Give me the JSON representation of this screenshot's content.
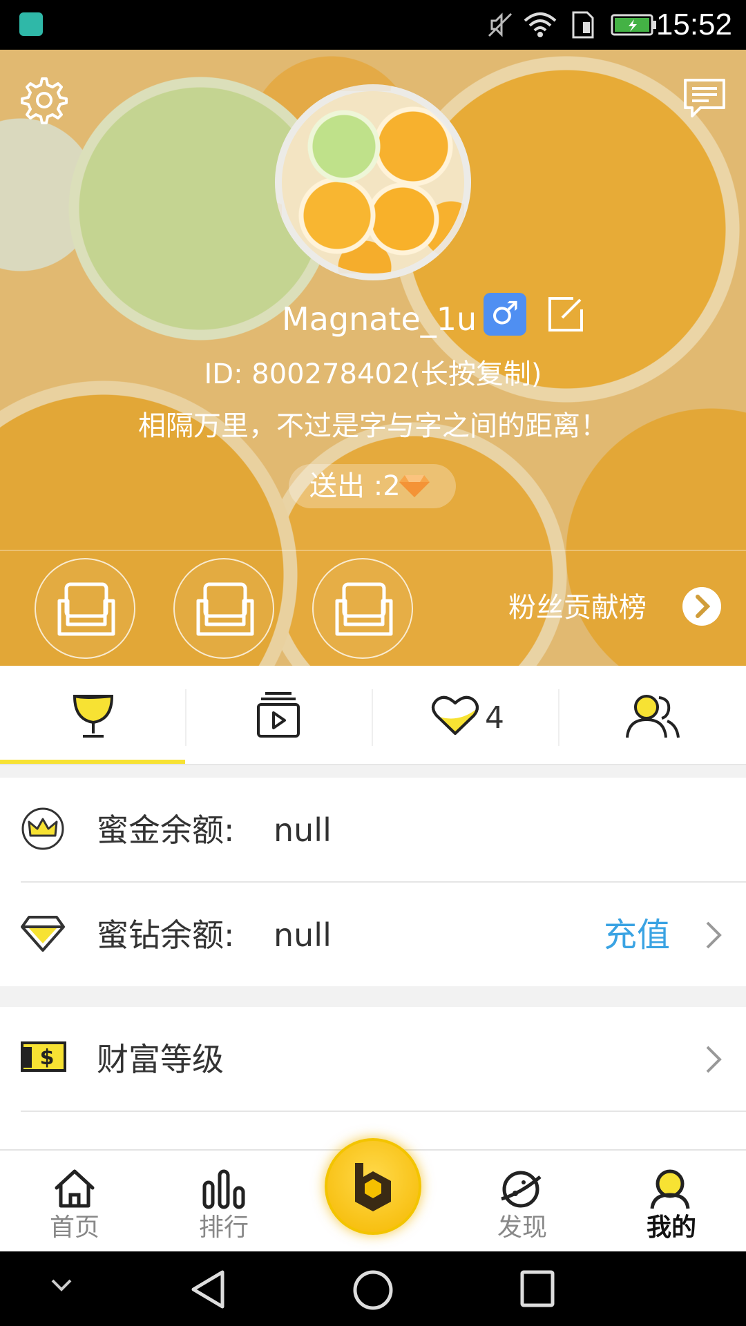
{
  "status_bar": {
    "time": "15:52",
    "icons": [
      "android-app-icon",
      "mute-icon",
      "wifi-icon",
      "sim-icon",
      "battery-charging-icon"
    ]
  },
  "header": {
    "icons": [
      "settings-icon",
      "message-icon"
    ],
    "username": "Magnate_1u",
    "gender_symbol": "♂",
    "user_id": "ID: 800278402(长按复制)",
    "signature": "相隔万里，不过是字与字之间的距离！",
    "sent_label": "送出 :2",
    "sent_icon": "diamond-icon",
    "seat_icon": "sofa-icon",
    "fans_ranking_label": "粉丝贡献榜",
    "colors": {
      "background_tint": "#f0c77b",
      "gender_badge": "#4f8ff2"
    }
  },
  "tabs": {
    "items": [
      {
        "icon": "trophy-icon",
        "active": true
      },
      {
        "icon": "video-icon"
      },
      {
        "icon": "heart-icon",
        "count": "4"
      },
      {
        "icon": "users-icon"
      }
    ],
    "active_color": "#f7e233"
  },
  "list": {
    "gold_balance": {
      "icon": "crown-icon",
      "label": "蜜金余额:",
      "value": "null"
    },
    "diamond_balance": {
      "icon": "diamond-outline-icon",
      "label": "蜜钻余额:",
      "value": "null",
      "action": "充值",
      "action_color": "#3aa3e3"
    },
    "wealth_level": {
      "icon": "money-icon",
      "label": "财富等级"
    }
  },
  "bottom_nav": {
    "items": [
      {
        "label": "首页",
        "icon": "home-icon"
      },
      {
        "label": "排行",
        "icon": "ranking-icon"
      },
      {
        "label": "",
        "icon": "center-logo-icon"
      },
      {
        "label": "发现",
        "icon": "planet-icon"
      },
      {
        "label": "我的",
        "icon": "profile-icon",
        "active": true
      }
    ]
  },
  "system_nav": {
    "icons": [
      "collapse-icon",
      "back-icon",
      "home-circle-icon",
      "recents-icon"
    ]
  }
}
